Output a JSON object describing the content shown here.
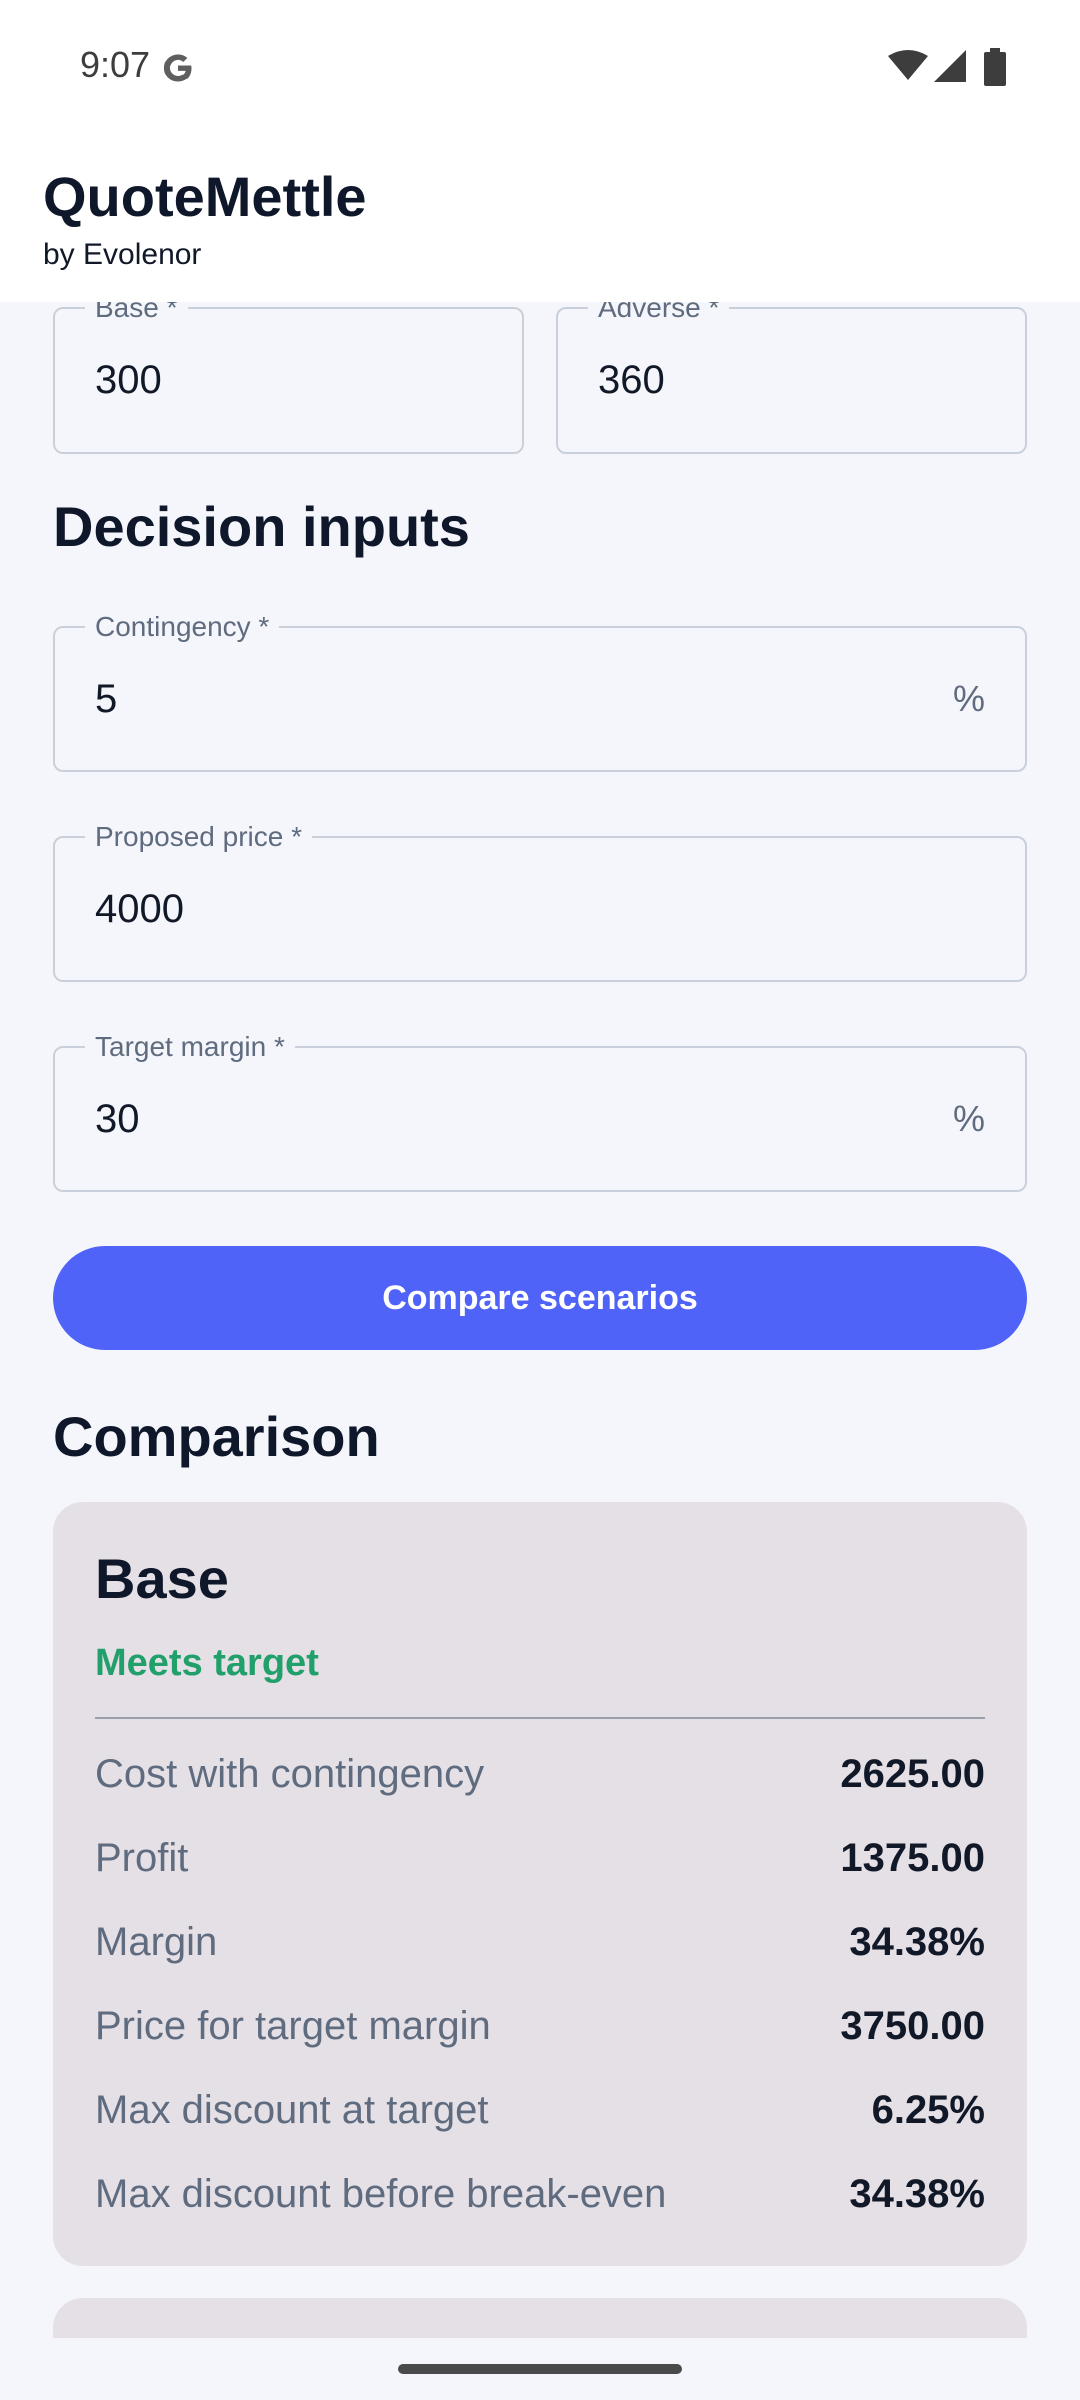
{
  "status_bar": {
    "time": "9:07",
    "icons": [
      "google-icon",
      "wifi-icon",
      "signal-icon",
      "battery-icon"
    ]
  },
  "header": {
    "title": "QuoteMettle",
    "subtitle": "by Evolenor"
  },
  "scenario_inputs": {
    "base": {
      "label": "Base *",
      "value": "300"
    },
    "adverse": {
      "label": "Adverse *",
      "value": "360"
    }
  },
  "decision_inputs": {
    "title": "Decision inputs",
    "contingency": {
      "label": "Contingency *",
      "value": "5",
      "suffix": "%"
    },
    "proposed_price": {
      "label": "Proposed price *",
      "value": "4000"
    },
    "target_margin": {
      "label": "Target margin *",
      "value": "30",
      "suffix": "%"
    }
  },
  "compare_button": {
    "label": "Compare scenarios"
  },
  "comparison": {
    "title": "Comparison",
    "cards": [
      {
        "title": "Base",
        "status": "Meets target",
        "status_color": "#22a06b",
        "metrics": [
          {
            "label": "Cost with contingency",
            "value": "2625.00"
          },
          {
            "label": "Profit",
            "value": "1375.00"
          },
          {
            "label": "Margin",
            "value": "34.38%"
          },
          {
            "label": "Price for target margin",
            "value": "3750.00"
          },
          {
            "label": "Max discount at target",
            "value": "6.25%"
          },
          {
            "label": "Max discount before break-even",
            "value": "34.38%"
          }
        ]
      }
    ]
  },
  "colors": {
    "accent": "#5063f8",
    "background": "#f4f6fb",
    "card": "#e5e0e6",
    "success": "#22a06b"
  }
}
